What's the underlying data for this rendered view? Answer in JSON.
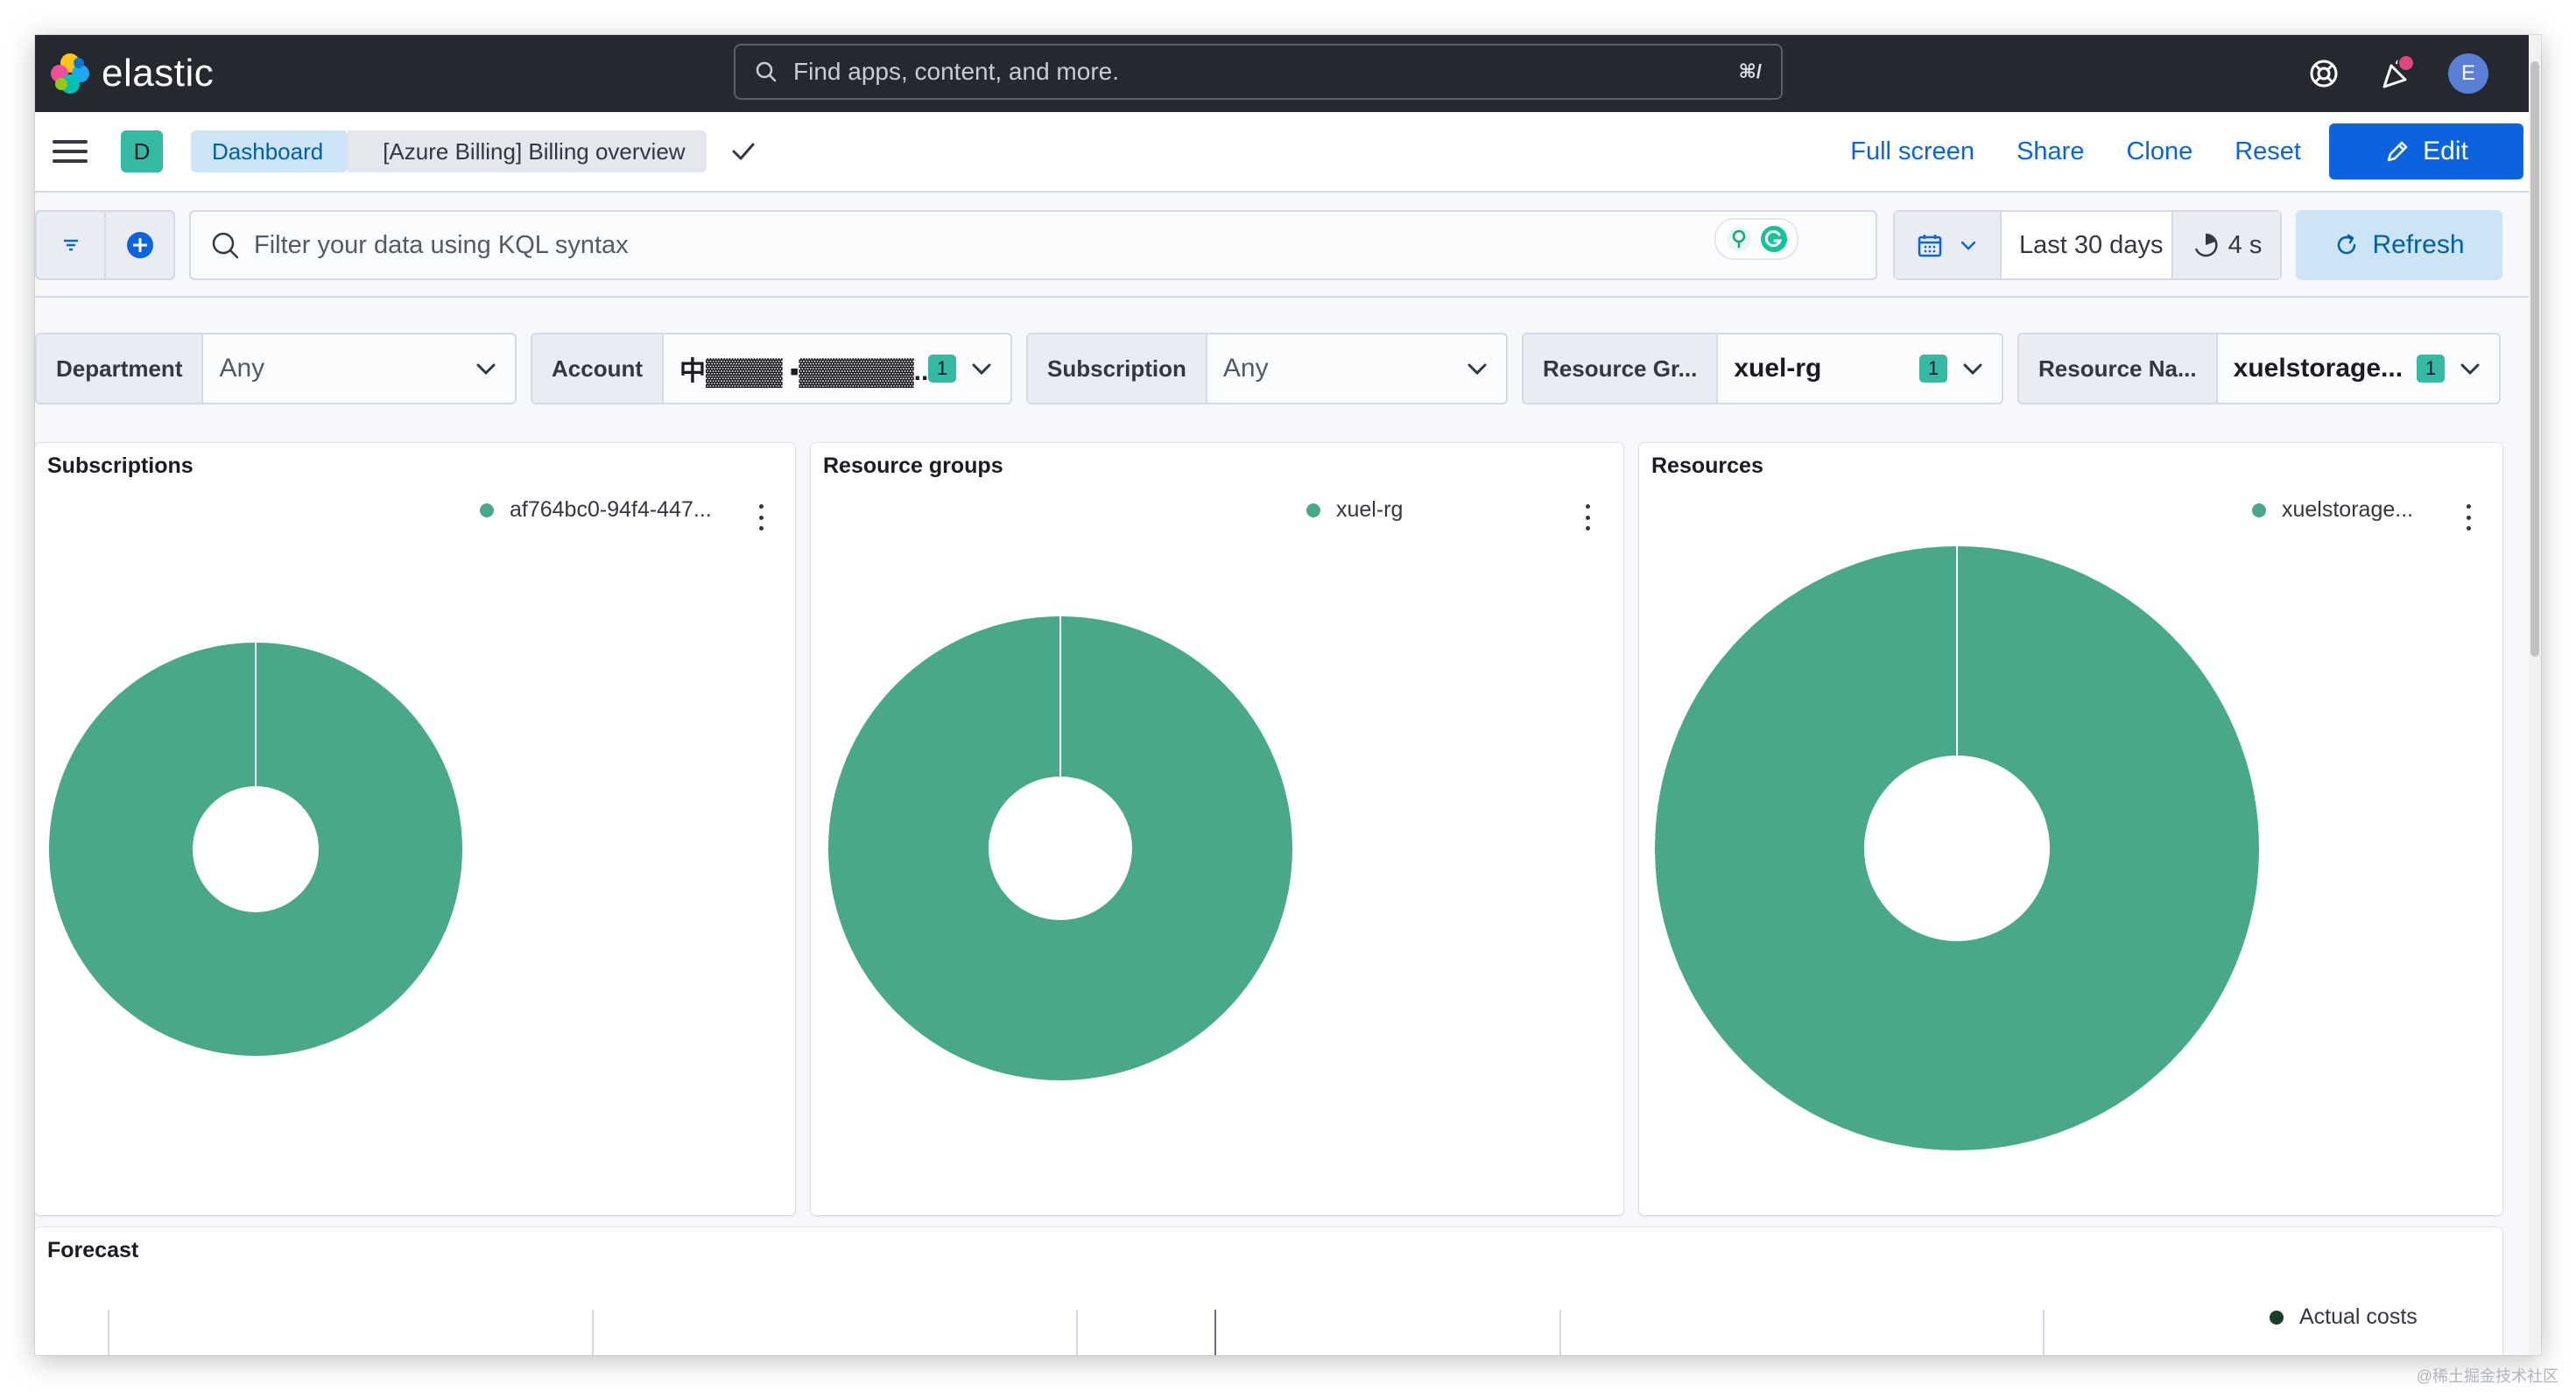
{
  "app": {
    "logo_text": "elastic"
  },
  "global_search": {
    "placeholder": "Find apps, content, and more.",
    "shortcut": "⌘/"
  },
  "header": {
    "avatar_initial": "E"
  },
  "nav": {
    "space_initial": "D",
    "breadcrumbs": [
      {
        "label": "Dashboard"
      },
      {
        "label": "[Azure Billing] Billing overview"
      }
    ],
    "actions": {
      "full_screen": "Full screen",
      "share": "Share",
      "clone": "Clone",
      "reset": "Reset",
      "edit": "Edit"
    }
  },
  "query": {
    "placeholder": "Filter your data using KQL syntax",
    "time_range": "Last 30 days",
    "refresh_interval": "4 s",
    "refresh_label": "Refresh"
  },
  "controls": [
    {
      "label": "Department",
      "value": "Any",
      "count": ""
    },
    {
      "label": "Account",
      "value": "中▓▓▓▓ ▪▓▓▓▓▓▓...",
      "count": "1"
    },
    {
      "label": "Subscription",
      "value": "Any",
      "count": ""
    },
    {
      "label": "Resource Gr...",
      "value": "xuel-rg",
      "count": "1"
    },
    {
      "label": "Resource Na...",
      "value": "xuelstorage...",
      "count": "1"
    }
  ],
  "panels": {
    "subscriptions": {
      "title": "Subscriptions",
      "legend": "af764bc0-94f4-447..."
    },
    "resource_groups": {
      "title": "Resource groups",
      "legend": "xuel-rg"
    },
    "resources": {
      "title": "Resources",
      "legend": "xuelstorage..."
    },
    "forecast": {
      "title": "Forecast",
      "legend": "Actual costs"
    }
  },
  "chart_data": [
    {
      "type": "pie",
      "title": "Subscriptions",
      "labels": [
        "af764bc0-94f4-447..."
      ],
      "values": [
        100
      ]
    },
    {
      "type": "pie",
      "title": "Resource groups",
      "labels": [
        "xuel-rg"
      ],
      "values": [
        100
      ]
    },
    {
      "type": "pie",
      "title": "Resources",
      "labels": [
        "xuelstorage..."
      ],
      "values": [
        100
      ]
    }
  ],
  "colors": {
    "series": "#48a888",
    "primary": "#0b64dd",
    "header_bg": "#25282f",
    "badge": "#36b9a3"
  },
  "watermark": "@稀土掘金技术社区"
}
